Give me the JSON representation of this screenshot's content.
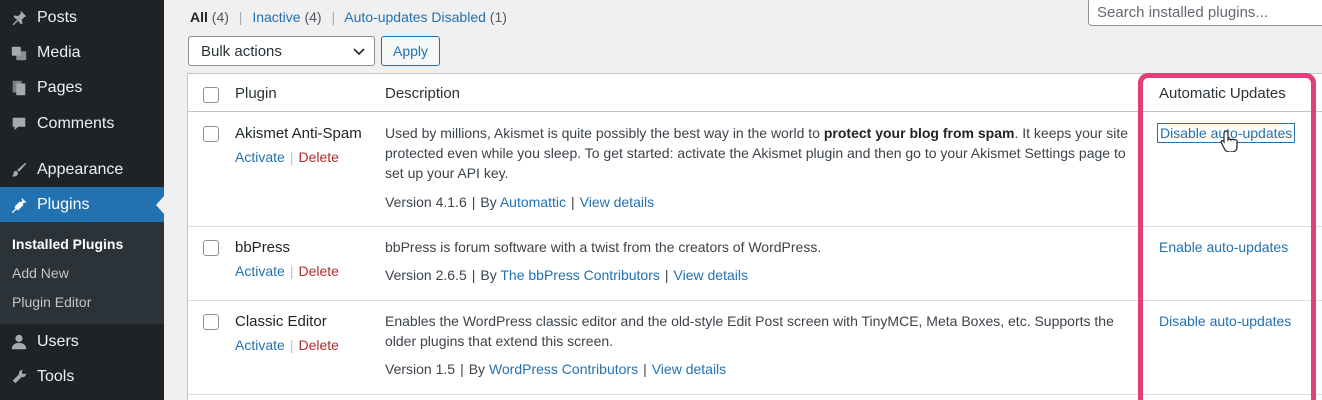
{
  "sidebar": {
    "items": [
      {
        "label": "Posts",
        "icon": "pin-icon"
      },
      {
        "label": "Media",
        "icon": "media-icon"
      },
      {
        "label": "Pages",
        "icon": "pages-icon"
      },
      {
        "label": "Comments",
        "icon": "comment-icon"
      },
      {
        "label": "Appearance",
        "icon": "brush-icon"
      },
      {
        "label": "Plugins",
        "icon": "plug-icon"
      },
      {
        "label": "Users",
        "icon": "user-icon"
      },
      {
        "label": "Tools",
        "icon": "wrench-icon"
      }
    ],
    "submenu": [
      "Installed Plugins",
      "Add New",
      "Plugin Editor"
    ]
  },
  "filters": {
    "all": "All",
    "all_count": "(4)",
    "inactive": "Inactive",
    "inactive_count": "(4)",
    "auto_disabled": "Auto-updates Disabled",
    "auto_disabled_count": "(1)",
    "separator": "|"
  },
  "search": {
    "placeholder": "Search installed plugins..."
  },
  "bulk": {
    "label": "Bulk actions",
    "apply": "Apply"
  },
  "table": {
    "headers": {
      "plugin": "Plugin",
      "description": "Description",
      "auto": "Automatic Updates"
    },
    "action_activate": "Activate",
    "action_delete": "Delete",
    "action_sep": "|",
    "version_prefix": "Version",
    "by": "By",
    "view_details": "View details",
    "meta_sep": "|",
    "rows": [
      {
        "name": "Akismet Anti-Spam",
        "desc_pre": "Used by millions, Akismet is quite possibly the best way in the world to ",
        "desc_bold": "protect your blog from spam",
        "desc_post": ". It keeps your site protected even while you sleep. To get started: activate the Akismet plugin and then go to your Akismet Settings page to set up your API key.",
        "version": "4.1.6",
        "author": "Automattic",
        "auto": "Disable auto-updates"
      },
      {
        "name": "bbPress",
        "desc_pre": "bbPress is forum software with a twist from the creators of WordPress.",
        "desc_bold": "",
        "desc_post": "",
        "version": "2.6.5",
        "author": "The bbPress Contributors",
        "auto": "Enable auto-updates"
      },
      {
        "name": "Classic Editor",
        "desc_pre": "Enables the WordPress classic editor and the old-style Edit Post screen with TinyMCE, Meta Boxes, etc. Supports the older plugins that extend this screen.",
        "desc_bold": "",
        "desc_post": "",
        "version": "1.5",
        "author": "WordPress Contributors",
        "auto": "Disable auto-updates"
      }
    ]
  },
  "colors": {
    "highlight": "#e0407a",
    "accent": "#2271b1",
    "sidebar": "#1d2327"
  }
}
